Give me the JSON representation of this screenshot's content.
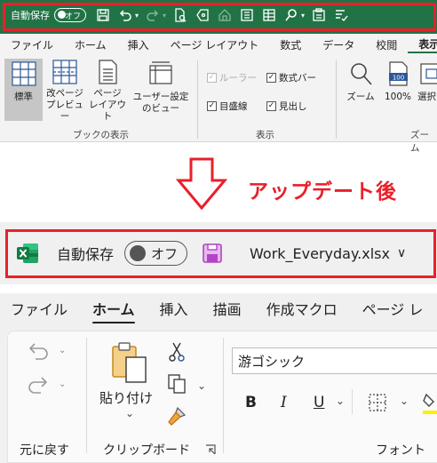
{
  "old": {
    "qat": {
      "autosave_label": "自動保存",
      "autosave_state": "オフ",
      "icons": [
        "save-icon",
        "undo-icon",
        "redo-icon",
        "print-preview-icon",
        "label-icon",
        "home-icon",
        "form-icon",
        "table-icon",
        "search-icon",
        "clipboard-icon",
        "checklist-icon"
      ]
    },
    "tabs": [
      "ファイル",
      "ホーム",
      "挿入",
      "ページ レイアウト",
      "数式",
      "データ",
      "校閲",
      "表示"
    ],
    "ribbon": {
      "workbook_views": {
        "group_label": "ブックの表示",
        "buttons": [
          {
            "label": "標準",
            "selected": true
          },
          {
            "label": "改ページ\nプレビュー"
          },
          {
            "label": "ページ\nレイアウト"
          },
          {
            "label": "ユーザー設定\nのビュー"
          }
        ]
      },
      "show": {
        "group_label": "表示",
        "checkboxes": [
          {
            "label": "ルーラー",
            "checked": true,
            "disabled": true
          },
          {
            "label": "数式バー",
            "checked": true
          },
          {
            "label": "目盛線",
            "checked": true
          },
          {
            "label": "見出し",
            "checked": true
          }
        ]
      },
      "zoom": {
        "group_label": "ズーム",
        "zoom_label": "ズーム",
        "zoom100_label": "100%",
        "zoom100_icon_text": "100",
        "selection_label": "選択"
      }
    }
  },
  "divider": {
    "text": "アップデート後"
  },
  "new": {
    "titlebar": {
      "autosave_label": "自動保存",
      "autosave_state": "オフ",
      "file_name": "Work_Everyday.xlsx",
      "file_dropdown": "∨"
    },
    "tabs": [
      "ファイル",
      "ホーム",
      "挿入",
      "描画",
      "作成マクロ",
      "ページ レ"
    ],
    "ribbon": {
      "undo_group_label": "元に戻す",
      "clipboard_label": "クリップボード",
      "paste_label": "貼り付け",
      "font_name": "游ゴシック",
      "font_group_label": "フォント",
      "bold": "B",
      "italic": "I",
      "underline": "U"
    }
  },
  "colors": {
    "excel_green": "#217346",
    "highlight_red": "#e8202a",
    "save_purple": "#b146c2"
  }
}
